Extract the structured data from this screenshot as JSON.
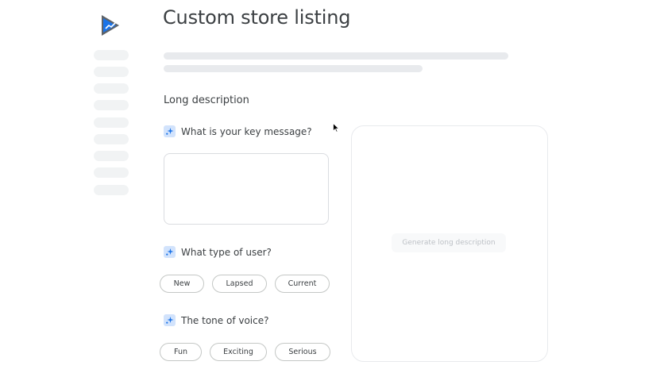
{
  "app": {
    "logo_icon": "play-console-icon",
    "brand_color": "#1a73e8"
  },
  "sidebar": {
    "items": [
      {
        "label": ""
      },
      {
        "label": ""
      },
      {
        "label": ""
      },
      {
        "label": ""
      },
      {
        "label": ""
      },
      {
        "label": ""
      },
      {
        "label": ""
      },
      {
        "label": ""
      },
      {
        "label": ""
      }
    ]
  },
  "header": {
    "title": "Custom store listing"
  },
  "section": {
    "title": "Long description"
  },
  "questions": {
    "key_message": {
      "label": "What is your key message?",
      "icon": "sparkle-icon",
      "value": ""
    },
    "user_type": {
      "label": "What type of user?",
      "icon": "sparkle-icon",
      "options": [
        "New",
        "Lapsed",
        "Current"
      ]
    },
    "tone": {
      "label": "The tone of voice?",
      "icon": "sparkle-icon",
      "options": [
        "Fun",
        "Exciting",
        "Serious"
      ]
    }
  },
  "preview": {
    "button_label": "Generate long description"
  },
  "colors": {
    "accent_light": "#d2e3fc",
    "placeholder": "#e8eaed",
    "text": "#3c4043"
  }
}
